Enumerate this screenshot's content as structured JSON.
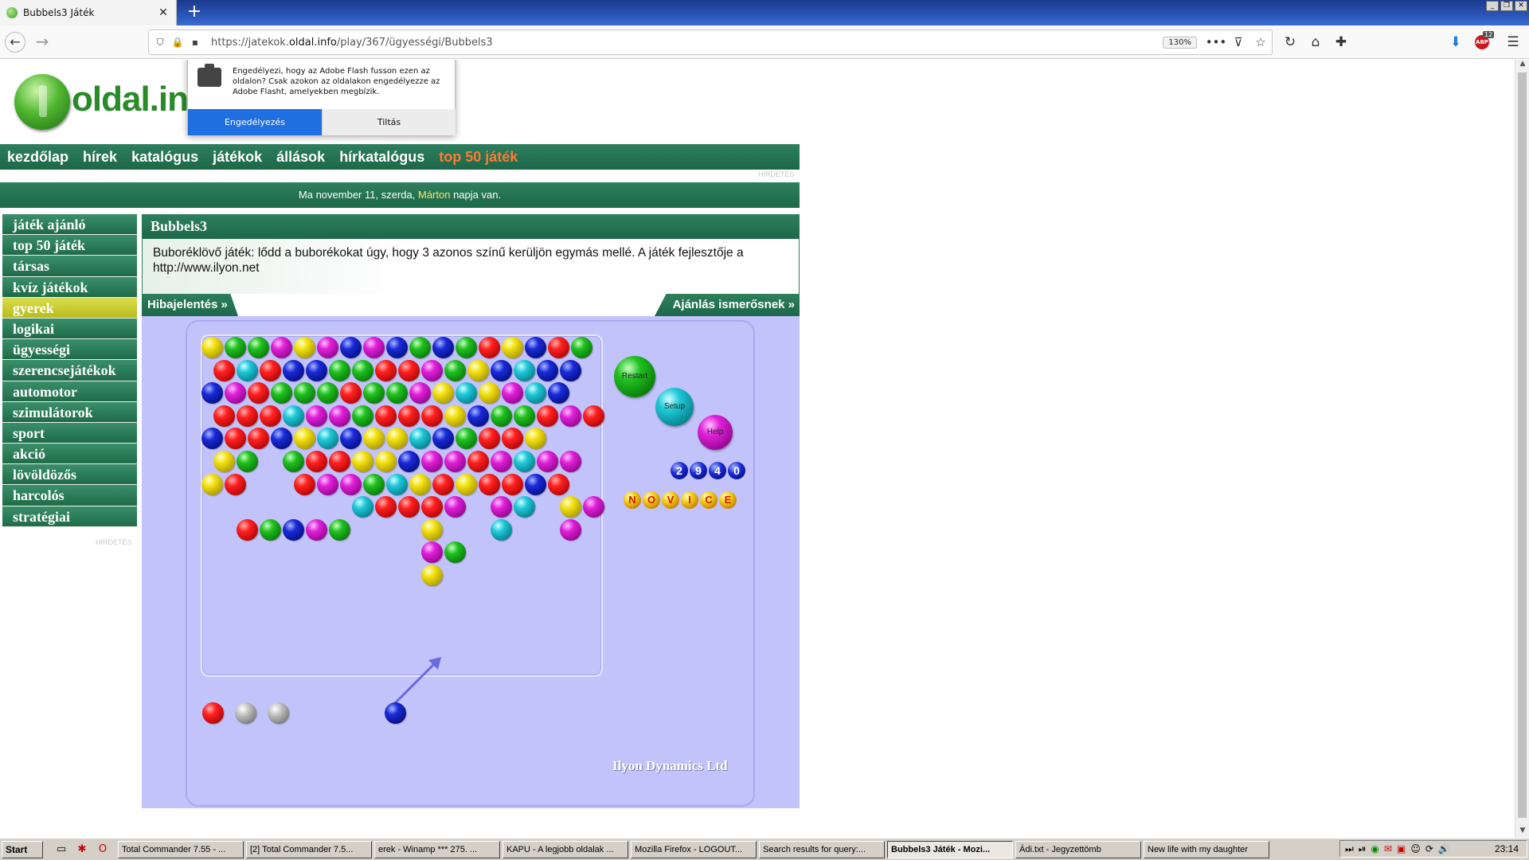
{
  "browser": {
    "tab_title": "Bubbels3 Játék",
    "url_prefix": "https://jatekok.",
    "url_domain": "oldal.info",
    "url_path": "/play/367/ügyességi/Bubbels3",
    "zoom": "130%",
    "abp_label": "ABP",
    "abp_count": "12"
  },
  "flash_popup": {
    "message": "Engedélyezi, hogy az Adobe Flash fusson ezen az oldalon? Csak azokon az oldalakon engedélyezze az Adobe Flasht, amelyekben megbízik.",
    "allow_label": "Engedélyezés",
    "deny_label": "Tiltás"
  },
  "site": {
    "logo_text": "oldal.in",
    "nav": [
      "kezdőlap",
      "hírek",
      "katalógus",
      "játékok",
      "állások",
      "hírkatalógus",
      "top 50 játék"
    ],
    "ad_label": "HIRDETÉS",
    "date_text_before": "Ma november 11, szerda,",
    "date_name": "Márton",
    "date_text_after": "napja van."
  },
  "sidebar": {
    "items": [
      "játék ajánló",
      "top 50 játék",
      "társas",
      "kvíz játékok",
      "gyerek",
      "logikai",
      "ügyességi",
      "szerencsejátékok",
      "automotor",
      "szimulátorok",
      "sport",
      "akció",
      "lövöldözős",
      "harcolós",
      "stratégiai"
    ],
    "active_index": 4,
    "ad_label": "HIRDETÉS"
  },
  "game_page": {
    "title": "Bubbels3",
    "description": "Buboréklövő játék: lődd a buborékokat úgy, hogy 3 azonos színű kerüljön egymás mellé. A játék fejlesztője a http://www.ilyon.net",
    "report_label": "Hibajelentés »",
    "recommend_label": "Ajánlás ismerősnek »"
  },
  "game": {
    "restart_label": "Restart",
    "setup_label": "Setup",
    "help_label": "Help",
    "score_digits": [
      "2",
      "9",
      "4",
      "0"
    ],
    "level_letters": [
      "N",
      "O",
      "V",
      "I",
      "C",
      "E"
    ],
    "credit": "Ilyon Dynamics Ltd",
    "bubble_rows": [
      "YGGMYMBMBGBGRYBRG",
      " RCRBBGGRRMGYBCBB",
      "BMRGGGRGGMYCYMCB",
      " RRRCMMGRRRYBGGRMR",
      "BRRBYCBYYCBGRRY",
      " YG GRRYYBMMRMCMM",
      "YR  RMMGCYRYRRBR",
      "       CRRRM MC YM",
      "  RGBMG   Y  C  M",
      "          MG",
      "          Y"
    ],
    "queue": [
      "red",
      "gray",
      "gray"
    ],
    "shooter": "blue"
  },
  "taskbar": {
    "start_label": "Start",
    "tasks": [
      "Total Commander 7.55 - ...",
      "[2] Total Commander 7.5...",
      "erek - Winamp *** 275. ...",
      "KAPU - A legjobb oldalak ...",
      "Mozilla Firefox - LOGOUT...",
      "Search results for query:...",
      "Bubbels3 Játék - Mozi...",
      "Ádi.txt - Jegyzettömb",
      "New life with my daughter"
    ],
    "active_index": 6,
    "clock": "23:14"
  }
}
